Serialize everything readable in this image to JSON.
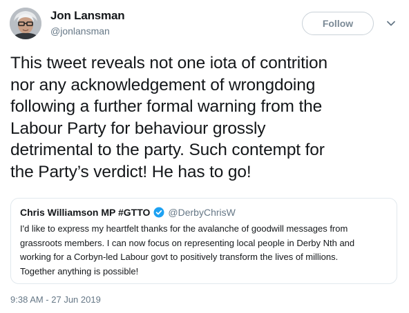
{
  "author": {
    "name": "Jon Lansman",
    "handle": "@jonlansman",
    "avatar_icon": "avatar-photo"
  },
  "actions": {
    "follow_label": "Follow",
    "menu_icon": "chevron-down-icon"
  },
  "tweet": {
    "lines": [
      "This tweet reveals not one iota of contrition",
      "nor any acknowledgement of wrongdoing",
      "following a further formal warning from the",
      "Labour Party for behaviour grossly",
      "detrimental to the party. Such contempt for",
      "the Party’s verdict! He has to go!"
    ],
    "timestamp": "9:38 AM - 27 Jun 2019"
  },
  "quoted_tweet": {
    "name": "Chris Williamson MP #GTTO",
    "verified_icon": "verified-badge-icon",
    "handle": "@DerbyChrisW",
    "lines": [
      "I'd like to express my heartfelt thanks for the avalanche of goodwill messages from",
      "grassroots members. I can now focus on representing local people in Derby Nth and",
      "working for a Corbyn-led Labour govt to positively transform the lives of millions.",
      "Together anything is possible!"
    ]
  },
  "colors": {
    "text": "#14171a",
    "secondary": "#657786",
    "verified": "#1da1f2",
    "border": "#e1e8ed"
  }
}
